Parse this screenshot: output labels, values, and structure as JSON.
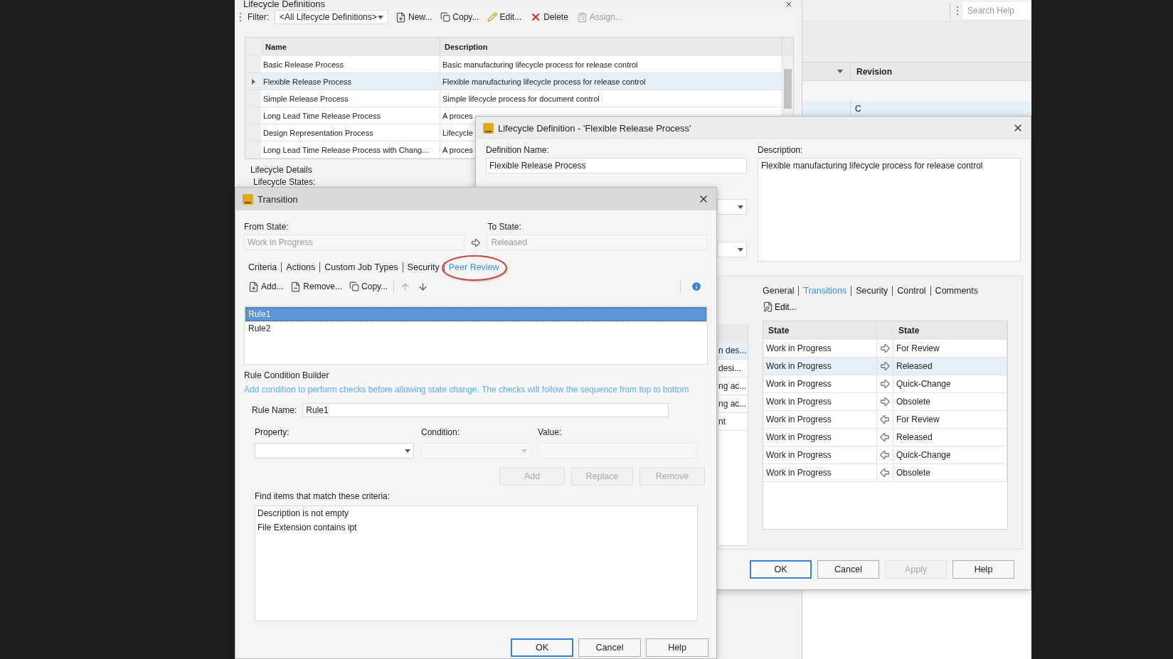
{
  "background_app": {
    "search": {
      "placeholder": "Search Help"
    },
    "column_header": "Revision",
    "rows": [
      {
        "revision": "C",
        "selected": true
      }
    ]
  },
  "definitions_window": {
    "title": "Lifecycle Definitions",
    "filter_label": "Filter:",
    "filter_value": "<All Lifecycle Definitions>",
    "toolbar": [
      {
        "kind": "new",
        "label": "New...",
        "disabled": false
      },
      {
        "kind": "copy",
        "label": "Copy...",
        "disabled": false
      },
      {
        "kind": "edit",
        "label": "Edit...",
        "disabled": false
      },
      {
        "kind": "delete",
        "label": "Delete",
        "disabled": false
      },
      {
        "kind": "assign",
        "label": "Assign...",
        "disabled": true
      }
    ],
    "columns": [
      "Name",
      "Description"
    ],
    "rows": [
      {
        "name": "Basic Release Process",
        "description": "Basic manufacturing lifecycle process for release control",
        "selected": false
      },
      {
        "name": "Flexible Release Process",
        "description": "Flexible manufacturing lifecycle process for release control",
        "selected": true
      },
      {
        "name": "Simple Release Process",
        "description": "Simple lifecycle process for document control",
        "selected": false
      },
      {
        "name": "Long Lead Time Release Process",
        "description": "A proces",
        "selected": false
      },
      {
        "name": "Design Representation Process",
        "description": "Lifecycle",
        "selected": false
      },
      {
        "name": "Long Lead Time Release Process with Chang...",
        "description": "A proces",
        "selected": false
      }
    ],
    "details_group": "Lifecycle Details",
    "states_label": "Lifecycle States:"
  },
  "definition_dialog": {
    "title": "Lifecycle Definition - 'Flexible Release Process'",
    "name_label": "Definition Name:",
    "name_value": "Flexible Release Process",
    "description_label": "Description:",
    "description_value": "Flexible manufacturing lifecycle process for release control",
    "side_list": [
      {
        "text": "n des...",
        "selected": true
      },
      {
        "text": "desi...",
        "selected": false
      },
      {
        "text": "ng ac...",
        "selected": false
      },
      {
        "text": "ng ac...",
        "selected": false
      },
      {
        "text": "nt",
        "selected": false
      }
    ],
    "tabs": [
      {
        "label": "General",
        "selected": false
      },
      {
        "label": "Transitions",
        "selected": true
      },
      {
        "label": "Security",
        "selected": false
      },
      {
        "label": "Control",
        "selected": false
      },
      {
        "label": "Comments",
        "selected": false
      }
    ],
    "edit_button": "Edit...",
    "columns": [
      "State",
      "State"
    ],
    "transitions": [
      {
        "from": "Work in Progress",
        "kind": "forward",
        "to": "For Review",
        "selected": false
      },
      {
        "from": "Work in Progress",
        "kind": "forward",
        "to": "Released",
        "selected": true
      },
      {
        "from": "Work in Progress",
        "kind": "forward",
        "to": "Quick-Change",
        "selected": false
      },
      {
        "from": "Work in Progress",
        "kind": "forward",
        "to": "Obsolete",
        "selected": false
      },
      {
        "from": "Work in Progress",
        "kind": "backward",
        "to": "For Review",
        "selected": false
      },
      {
        "from": "Work in Progress",
        "kind": "backward",
        "to": "Released",
        "selected": false
      },
      {
        "from": "Work in Progress",
        "kind": "backward",
        "to": "Quick-Change",
        "selected": false
      },
      {
        "from": "Work in Progress",
        "kind": "backward",
        "to": "Obsolete",
        "selected": false
      }
    ],
    "buttons": [
      {
        "label": "OK",
        "default": true,
        "disabled": false
      },
      {
        "label": "Cancel",
        "default": false,
        "disabled": false
      },
      {
        "label": "Apply",
        "default": false,
        "disabled": true
      },
      {
        "label": "Help",
        "default": false,
        "disabled": false
      }
    ]
  },
  "transition_dialog": {
    "title": "Transition",
    "from_label": "From State:",
    "from_value": "Work in Progress",
    "to_label": "To State:",
    "to_value": "Released",
    "tabs": [
      {
        "label": "Criteria",
        "selected": false,
        "circled": false
      },
      {
        "label": "Actions",
        "selected": false,
        "circled": false
      },
      {
        "label": "Custom Job Types",
        "selected": false,
        "circled": false
      },
      {
        "label": "Security",
        "selected": false,
        "circled": false
      },
      {
        "label": "Peer Review",
        "selected": true,
        "circled": true
      }
    ],
    "toolbar": [
      {
        "kind": "add",
        "label": "Add...",
        "disabled": false
      },
      {
        "kind": "remove",
        "label": "Remove...",
        "disabled": false
      },
      {
        "kind": "copy",
        "label": "Copy...",
        "disabled": false
      },
      {
        "kind": "up",
        "disabled": true
      },
      {
        "kind": "down",
        "disabled": false
      }
    ],
    "rules": [
      {
        "name": "Rule1",
        "selected": true
      },
      {
        "name": "Rule2",
        "selected": false
      }
    ],
    "builder_title": "Rule Condition Builder",
    "hint": "Add condition to perform checks before allowing state change. The checks will follow the sequence from top to bottom",
    "rule_name_label": "Rule Name:",
    "rule_name_value": "Rule1",
    "fields": [
      {
        "kind": "dropdown",
        "label": "Property:",
        "disabled": false
      },
      {
        "kind": "dropdown",
        "label": "Condition:",
        "disabled": true
      },
      {
        "kind": "text",
        "label": "Value:",
        "disabled": true
      }
    ],
    "condition_buttons": [
      {
        "label": "Add",
        "disabled": true
      },
      {
        "label": "Replace",
        "disabled": true
      },
      {
        "label": "Remove",
        "disabled": true
      }
    ],
    "criteria_label": "Find items that match these criteria:",
    "criteria": [
      "Description is not empty",
      "File Extension contains ipt"
    ],
    "buttons": [
      {
        "label": "OK",
        "default": true
      },
      {
        "label": "Cancel",
        "default": false
      },
      {
        "label": "Help",
        "default": false
      }
    ]
  }
}
